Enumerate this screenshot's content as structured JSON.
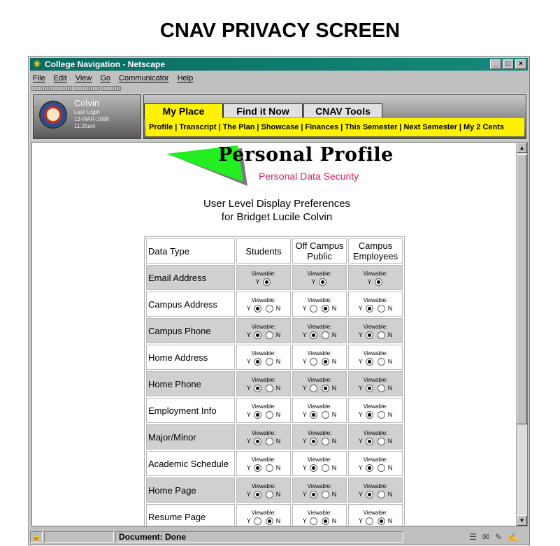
{
  "page_heading": "CNAV PRIVACY SCREEN",
  "window": {
    "title": "College Navigation - Netscape",
    "controls": [
      "_",
      "□",
      "×"
    ]
  },
  "menu": [
    "File",
    "Edit",
    "View",
    "Go",
    "Communicator",
    "Help"
  ],
  "user": {
    "name": "Colvin",
    "last_login_label": "Last Login",
    "last_login_date": "13-MAR-1998",
    "last_login_time": "11:25am"
  },
  "tabs": [
    {
      "label": "My Place",
      "active": true
    },
    {
      "label": "Find it Now",
      "active": false
    },
    {
      "label": "CNAV Tools",
      "active": false
    }
  ],
  "subnav": [
    "Profile",
    "Transcript",
    "The Plan",
    "Showcase",
    "Finances",
    "This Semester",
    "Next Semester",
    "My 2 Cents"
  ],
  "banner": {
    "title": "Personal Profile",
    "subtitle": "Personal Data Security"
  },
  "prefs_title_line1": "User Level Display Preferences",
  "prefs_title_line2": "for Bridget Lucile Colvin",
  "table": {
    "headers": {
      "data_type": "Data Type",
      "students": "Students",
      "off_campus": "Off Campus Public",
      "campus_employees": "Campus Employees"
    },
    "viewable_label": "Viewable:",
    "yes_label": "Y",
    "no_label": "N",
    "rows": [
      {
        "label": "Email Address",
        "students": "Y",
        "off_campus": "Y",
        "campus_employees": "Y",
        "locked": true
      },
      {
        "label": "Campus Address",
        "students": "Y",
        "off_campus": "N",
        "campus_employees": "Y"
      },
      {
        "label": "Campus Phone",
        "students": "Y",
        "off_campus": "Y",
        "campus_employees": "Y"
      },
      {
        "label": "Home Address",
        "students": "Y",
        "off_campus": "N",
        "campus_employees": "Y"
      },
      {
        "label": "Home Phone",
        "students": "Y",
        "off_campus": "N",
        "campus_employees": "Y"
      },
      {
        "label": "Employment Info",
        "students": "Y",
        "off_campus": "Y",
        "campus_employees": "Y"
      },
      {
        "label": "Major/Minor",
        "students": "Y",
        "off_campus": "Y",
        "campus_employees": "Y"
      },
      {
        "label": "Academic Schedule",
        "students": "Y",
        "off_campus": "Y",
        "campus_employees": "Y"
      },
      {
        "label": "Home Page",
        "students": "Y",
        "off_campus": "Y",
        "campus_employees": "Y"
      },
      {
        "label": "Resume Page",
        "students": "N",
        "off_campus": "N",
        "campus_employees": "N"
      }
    ]
  },
  "status": {
    "text": "Document: Done"
  },
  "icons": {
    "app": "netscape-star-icon",
    "lock": "security-lock-icon",
    "status_tray": [
      "component-bar-icon",
      "mail-icon",
      "discussion-icon",
      "composer-icon"
    ]
  },
  "colors": {
    "title_bar": "#0a6a60",
    "tab_active": "#fff200",
    "banner_subtitle": "#d21e6e",
    "banner_triangle": "#22ee22"
  }
}
